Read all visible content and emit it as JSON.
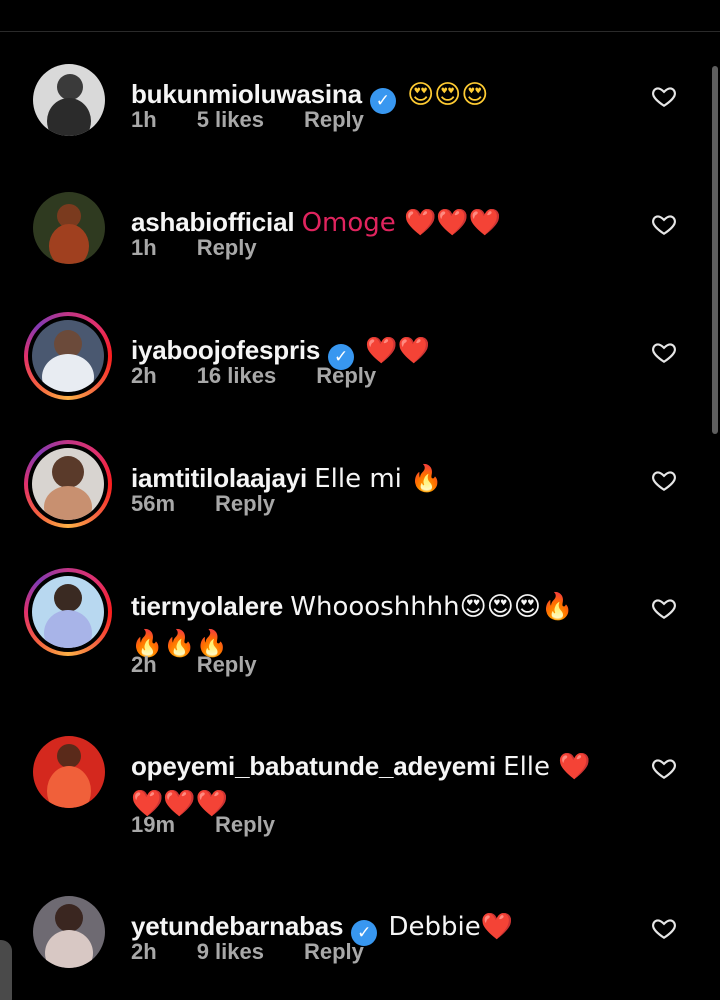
{
  "colors": {
    "background": "#000000",
    "text": "#f5f5f5",
    "meta": "#a8a8a8",
    "verified": "#3897f0",
    "heart": "#e0245e",
    "story_ring": "#e1306c"
  },
  "comments": [
    {
      "username": "bukunmioluwasina",
      "verified": true,
      "story_ring": false,
      "text": "😍😍😍",
      "time": "1h",
      "likes": "5 likes",
      "reply": "Reply",
      "like_icon": "heart-outline-icon"
    },
    {
      "username": "ashabiofficial",
      "verified": false,
      "story_ring": false,
      "text": "Omoge ❤️❤️❤️",
      "time": "1h",
      "likes": "",
      "reply": "Reply",
      "like_icon": "heart-outline-icon"
    },
    {
      "username": "iyaboojofespris",
      "verified": true,
      "story_ring": true,
      "text": "❤️❤️",
      "time": "2h",
      "likes": "16 likes",
      "reply": "Reply",
      "like_icon": "heart-outline-icon"
    },
    {
      "username": "iamtitilolaajayi",
      "verified": false,
      "story_ring": true,
      "text": "Elle mi 🔥",
      "time": "56m",
      "likes": "",
      "reply": "Reply",
      "like_icon": "heart-outline-icon"
    },
    {
      "username": "tiernyolalere",
      "verified": false,
      "story_ring": true,
      "text": "Whoooshhhh😍😍😍🔥",
      "text_line2": "🔥🔥🔥",
      "time": "2h",
      "likes": "",
      "reply": "Reply",
      "like_icon": "heart-outline-icon"
    },
    {
      "username": "opeyemi_babatunde_adeyemi",
      "verified": false,
      "story_ring": false,
      "text": "Elle ❤️",
      "text_line2": "❤️❤️❤️",
      "time": "19m",
      "likes": "",
      "reply": "Reply",
      "like_icon": "heart-outline-icon"
    },
    {
      "username": "yetundebarnabas",
      "verified": true,
      "story_ring": false,
      "text": "Debbie❤️",
      "time": "2h",
      "likes": "9 likes",
      "reply": "Reply",
      "like_icon": "heart-outline-icon"
    }
  ]
}
